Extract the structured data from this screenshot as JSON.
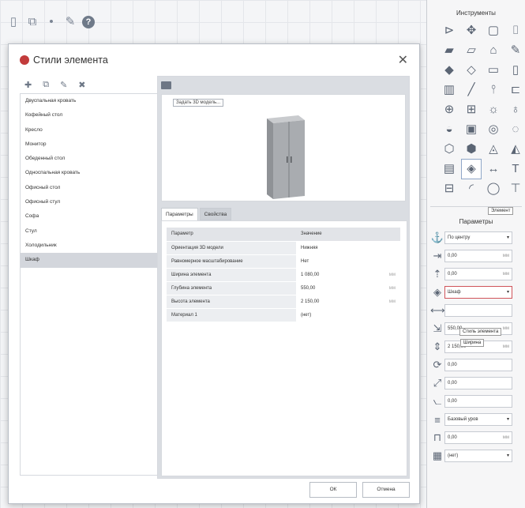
{
  "right_panel": {
    "tools_title": "Инструменты",
    "tool_tooltip": "Элемент",
    "params_title": "Параметры",
    "params": [
      {
        "icon": "anchor-icon",
        "value": "По центру",
        "unit": "",
        "select": true
      },
      {
        "icon": "offset-x-icon",
        "value": "0,00",
        "unit": "мм",
        "select": false
      },
      {
        "icon": "elevation-icon",
        "value": "0,00",
        "unit": "мм",
        "select": false
      },
      {
        "icon": "style-icon",
        "value": "Шкаф",
        "unit": "",
        "select": true
      },
      {
        "icon": "width-icon",
        "value": "",
        "unit": "",
        "select": false
      },
      {
        "icon": "depth-icon",
        "value": "550,00",
        "unit": "мм",
        "select": false
      },
      {
        "icon": "height-icon",
        "value": "2 150,00",
        "unit": "мм",
        "select": false
      },
      {
        "icon": "rotation-icon",
        "value": "0,00",
        "unit": "",
        "select": false
      },
      {
        "icon": "scale-icon",
        "value": "0,00",
        "unit": "",
        "select": false
      },
      {
        "icon": "tilt-icon",
        "value": "0,00",
        "unit": "",
        "select": false
      },
      {
        "icon": "level-icon",
        "value": "Базовый уров",
        "unit": "",
        "select": true
      },
      {
        "icon": "offset-level-icon",
        "value": "0,00",
        "unit": "мм",
        "select": false
      },
      {
        "icon": "material-icon",
        "value": "(нет)",
        "unit": "",
        "select": true
      }
    ],
    "style_tooltip": "Стиль элемента",
    "width_tooltip": "Ширина"
  },
  "dialog": {
    "title": "Стили элемента",
    "styles": [
      "Двуспальная кровать",
      "Кофейный стол",
      "Кресло",
      "Монитор",
      "Обеденный стол",
      "Односпальная кровать",
      "Офисный стол",
      "Офисный стул",
      "Софа",
      "Стул",
      "Холодильник",
      "Шкаф"
    ],
    "selected_style": "Шкаф",
    "set_model_label": "Задать 3D модель...",
    "tabs": [
      "Параметры",
      "Свойства"
    ],
    "table": {
      "headers": [
        "Параметр",
        "Значение"
      ],
      "rows": [
        {
          "param": "Ориентация 3D модели",
          "value": "Нижняя",
          "unit": ""
        },
        {
          "param": "Равномерное масштабирование",
          "value": "Нет",
          "unit": ""
        },
        {
          "param": "Ширина элемента",
          "value": "1 080,00",
          "unit": "мм"
        },
        {
          "param": "Глубина элемента",
          "value": "550,00",
          "unit": "мм"
        },
        {
          "param": "Высота элемента",
          "value": "2 150,00",
          "unit": "мм"
        },
        {
          "param": "Материал 1",
          "value": "(нет)",
          "unit": ""
        }
      ]
    },
    "ok_label": "ОК",
    "cancel_label": "Отмена"
  }
}
